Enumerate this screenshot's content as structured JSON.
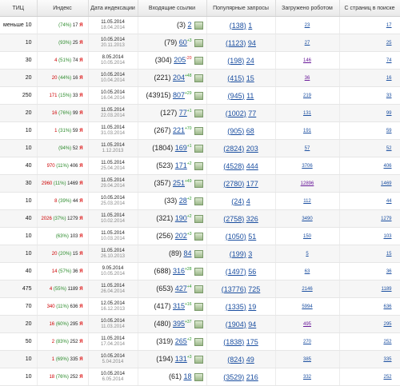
{
  "headers": [
    "ТИЦ",
    "Индекс",
    "Дата индексации",
    "Входящие ссылки",
    "Популярные запросы",
    "Загружено роботом",
    "С страниц в поиске"
  ],
  "rows": [
    {
      "tic": "меньше 10",
      "idx_num": "",
      "idx_pct": "(74%)",
      "idx_total": "17",
      "d1": "11.05.2014",
      "d2": "18.04.2014",
      "l_tot": "(3)",
      "l_new": "2",
      "l_delta": "",
      "l_dir": "",
      "q_tot": "(138)",
      "q_val": "1",
      "loaded": "23",
      "loaded_v": false,
      "pages": "17"
    },
    {
      "tic": "10",
      "idx_num": "",
      "idx_pct": "(93%)",
      "idx_total": "25",
      "d1": "10.05.2014",
      "d2": "20.11.2013",
      "l_tot": "(79)",
      "l_new": "60",
      "l_delta": "+3",
      "l_dir": "up",
      "q_tot": "(1123)",
      "q_val": "94",
      "loaded": "27",
      "loaded_v": false,
      "pages": "25"
    },
    {
      "tic": "30",
      "idx_num": "4",
      "idx_pct": "(51%)",
      "idx_total": "74",
      "d1": "8.05.2014",
      "d2": "10.05.2014",
      "l_tot": "(304)",
      "l_new": "205",
      "l_delta": "-20",
      "l_dir": "dn",
      "q_tot": "(198)",
      "q_val": "24",
      "loaded": "146",
      "loaded_v": true,
      "pages": "74"
    },
    {
      "tic": "20",
      "idx_num": "20",
      "idx_pct": "(44%)",
      "idx_total": "16",
      "d1": "10.05.2014",
      "d2": "10.04.2014",
      "l_tot": "(221)",
      "l_new": "204",
      "l_delta": "+48",
      "l_dir": "up",
      "q_tot": "(415)",
      "q_val": "15",
      "loaded": "36",
      "loaded_v": true,
      "pages": "16"
    },
    {
      "tic": "250",
      "idx_num": "171",
      "idx_pct": "(15%)",
      "idx_total": "33",
      "d1": "10.05.2014",
      "d2": "16.04.2014",
      "l_tot": "(43915)",
      "l_new": "807",
      "l_delta": "+29",
      "l_dir": "up",
      "q_tot": "(945)",
      "q_val": "11",
      "loaded": "219",
      "loaded_v": false,
      "pages": "33"
    },
    {
      "tic": "20",
      "idx_num": "16",
      "idx_pct": "(76%)",
      "idx_total": "99",
      "d1": "11.05.2014",
      "d2": "22.03.2014",
      "l_tot": "(127)",
      "l_new": "77",
      "l_delta": "+1",
      "l_dir": "up",
      "q_tot": "(1002)",
      "q_val": "77",
      "loaded": "131",
      "loaded_v": false,
      "pages": "99"
    },
    {
      "tic": "10",
      "idx_num": "1",
      "idx_pct": "(31%)",
      "idx_total": "59",
      "d1": "11.05.2014",
      "d2": "31.03.2014",
      "l_tot": "(267)",
      "l_new": "221",
      "l_delta": "+70",
      "l_dir": "up",
      "q_tot": "(905)",
      "q_val": "68",
      "loaded": "191",
      "loaded_v": false,
      "pages": "59"
    },
    {
      "tic": "10",
      "idx_num": "",
      "idx_pct": "(94%)",
      "idx_total": "52",
      "d1": "11.05.2014",
      "d2": "1.12.2013",
      "l_tot": "(1804)",
      "l_new": "169",
      "l_delta": "+1",
      "l_dir": "up",
      "q_tot": "(2824)",
      "q_val": "203",
      "loaded": "57",
      "loaded_v": false,
      "pages": "52"
    },
    {
      "tic": "40",
      "idx_num": "970",
      "idx_pct": "(11%)",
      "idx_total": "406",
      "d1": "11.05.2014",
      "d2": "25.04.2014",
      "l_tot": "(523)",
      "l_new": "171",
      "l_delta": "+2",
      "l_dir": "up",
      "q_tot": "(4528)",
      "q_val": "444",
      "loaded": "3706",
      "loaded_v": false,
      "pages": "406"
    },
    {
      "tic": "30",
      "idx_num": "2960",
      "idx_pct": "(11%)",
      "idx_total": "1469",
      "d1": "11.05.2014",
      "d2": "29.04.2014",
      "l_tot": "(357)",
      "l_new": "251",
      "l_delta": "+49",
      "l_dir": "up",
      "q_tot": "(2780)",
      "q_val": "177",
      "loaded": "12896",
      "loaded_v": true,
      "pages": "1469"
    },
    {
      "tic": "10",
      "idx_num": "8",
      "idx_pct": "(39%)",
      "idx_total": "44",
      "d1": "10.05.2014",
      "d2": "25.03.2014",
      "l_tot": "(33)",
      "l_new": "28",
      "l_delta": "+2",
      "l_dir": "up",
      "q_tot": "(24)",
      "q_val": "4",
      "loaded": "112",
      "loaded_v": false,
      "pages": "44"
    },
    {
      "tic": "40",
      "idx_num": "2026",
      "idx_pct": "(37%)",
      "idx_total": "1279",
      "d1": "11.05.2014",
      "d2": "10.02.2014",
      "l_tot": "(321)",
      "l_new": "190",
      "l_delta": "+2",
      "l_dir": "up",
      "q_tot": "(2758)",
      "q_val": "326",
      "loaded": "3490",
      "loaded_v": false,
      "pages": "1279"
    },
    {
      "tic": "10",
      "idx_num": "",
      "idx_pct": "(63%)",
      "idx_total": "103",
      "d1": "11.05.2014",
      "d2": "10.03.2014",
      "l_tot": "(256)",
      "l_new": "202",
      "l_delta": "+3",
      "l_dir": "up",
      "q_tot": "(1050)",
      "q_val": "51",
      "loaded": "150",
      "loaded_v": false,
      "pages": "103"
    },
    {
      "tic": "10",
      "idx_num": "20",
      "idx_pct": "(20%)",
      "idx_total": "15",
      "d1": "11.05.2014",
      "d2": "26.10.2013",
      "l_tot": "(89)",
      "l_new": "84",
      "l_delta": "",
      "l_dir": "",
      "q_tot": "(199)",
      "q_val": "3",
      "loaded": "5",
      "loaded_v": false,
      "pages": "15"
    },
    {
      "tic": "40",
      "idx_num": "14",
      "idx_pct": "(57%)",
      "idx_total": "36",
      "d1": "9.05.2014",
      "d2": "10.05.2014",
      "l_tot": "(688)",
      "l_new": "316",
      "l_delta": "+28",
      "l_dir": "up",
      "q_tot": "(1497)",
      "q_val": "56",
      "loaded": "63",
      "loaded_v": false,
      "pages": "36"
    },
    {
      "tic": "475",
      "idx_num": "4",
      "idx_pct": "(55%)",
      "idx_total": "1189",
      "d1": "11.05.2014",
      "d2": "26.04.2014",
      "l_tot": "(653)",
      "l_new": "427",
      "l_delta": "+4",
      "l_dir": "up",
      "q_tot": "(13776)",
      "q_val": "725",
      "loaded": "2146",
      "loaded_v": false,
      "pages": "1189"
    },
    {
      "tic": "70",
      "idx_num": "340",
      "idx_pct": "(11%)",
      "idx_total": "636",
      "d1": "12.05.2014",
      "d2": "16.12.2013",
      "l_tot": "(417)",
      "l_new": "315",
      "l_delta": "+16",
      "l_dir": "up",
      "q_tot": "(1335)",
      "q_val": "19",
      "loaded": "5994",
      "loaded_v": false,
      "pages": "636"
    },
    {
      "tic": "20",
      "idx_num": "16",
      "idx_pct": "(60%)",
      "idx_total": "295",
      "d1": "10.05.2014",
      "d2": "11.03.2014",
      "l_tot": "(480)",
      "l_new": "395",
      "l_delta": "+37",
      "l_dir": "up",
      "q_tot": "(1904)",
      "q_val": "94",
      "loaded": "495",
      "loaded_v": true,
      "pages": "295"
    },
    {
      "tic": "50",
      "idx_num": "2",
      "idx_pct": "(83%)",
      "idx_total": "252",
      "d1": "11.05.2014",
      "d2": "17.04.2014",
      "l_tot": "(319)",
      "l_new": "265",
      "l_delta": "+2",
      "l_dir": "up",
      "q_tot": "(1838)",
      "q_val": "175",
      "loaded": "270",
      "loaded_v": false,
      "pages": "252"
    },
    {
      "tic": "10",
      "idx_num": "1",
      "idx_pct": "(69%)",
      "idx_total": "335",
      "d1": "10.05.2014",
      "d2": "5.04.2014",
      "l_tot": "(194)",
      "l_new": "131",
      "l_delta": "+3",
      "l_dir": "up",
      "q_tot": "(824)",
      "q_val": "49",
      "loaded": "385",
      "loaded_v": false,
      "pages": "335"
    },
    {
      "tic": "10",
      "idx_num": "18",
      "idx_pct": "(76%)",
      "idx_total": "252",
      "d1": "10.05.2014",
      "d2": "6.05.2014",
      "l_tot": "(61)",
      "l_new": "18",
      "l_delta": "",
      "l_dir": "",
      "q_tot": "(3529)",
      "q_val": "216",
      "loaded": "332",
      "loaded_v": false,
      "pages": "252"
    }
  ],
  "ya_mark": "Я",
  "icons": {
    "links_thumb": "chart-thumb-icon"
  }
}
